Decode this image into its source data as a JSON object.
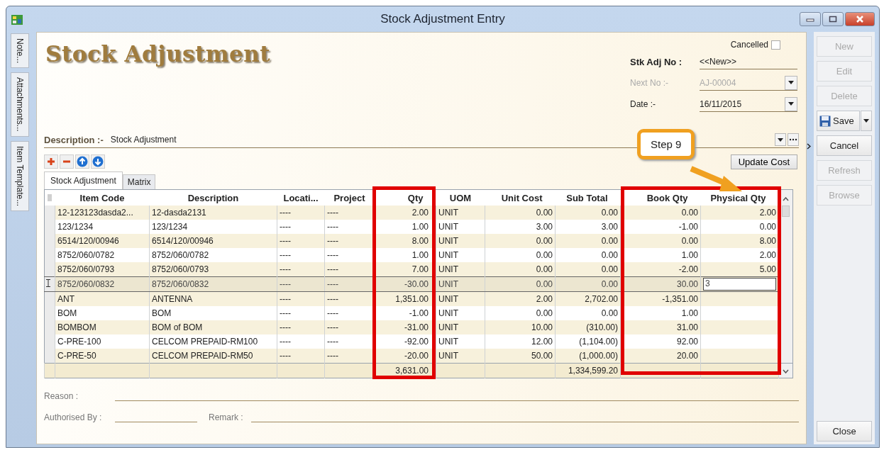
{
  "window": {
    "title": "Stock Adjustment Entry"
  },
  "side_tabs": [
    "Note...",
    "Attachments...",
    "Item Template..."
  ],
  "heading": "Stock Adjustment",
  "cancelled": {
    "label": "Cancelled",
    "checked": false
  },
  "fields": [
    {
      "kind": "text",
      "label": "Stk Adj No :",
      "value": "<<New>>",
      "disabled": false
    },
    {
      "kind": "combo",
      "label": "Next No :-",
      "value": "AJ-00004",
      "disabled": true
    },
    {
      "kind": "combo",
      "label": "Date :-",
      "value": "16/11/2015",
      "disabled": false
    }
  ],
  "description": {
    "label": "Description :-",
    "value": "Stock Adjustment"
  },
  "update_cost": "Update Cost",
  "tabs": [
    {
      "label": "Stock Adjustment",
      "selected": true
    },
    {
      "label": "Matrix",
      "selected": false
    }
  ],
  "callout": "Step 9",
  "table": {
    "columns": [
      "Item Code",
      "Description",
      "Locati...",
      "Project",
      "Qty",
      "UOM",
      "Unit Cost",
      "Sub Total",
      "Book Qty",
      "Physical Qty"
    ],
    "rows": [
      {
        "selected": false,
        "cells": [
          "12-123123dasda2...",
          "12-dasda2131",
          "----",
          "----",
          "2.00",
          "UNIT",
          "0.00",
          "0.00",
          "0.00",
          "2.00"
        ]
      },
      {
        "selected": false,
        "cells": [
          "123/1234",
          "123/1234",
          "----",
          "----",
          "1.00",
          "UNIT",
          "3.00",
          "3.00",
          "-1.00",
          "0.00"
        ]
      },
      {
        "selected": false,
        "cells": [
          "6514/120/00946",
          "6514/120/00946",
          "----",
          "----",
          "8.00",
          "UNIT",
          "0.00",
          "0.00",
          "0.00",
          "8.00"
        ]
      },
      {
        "selected": false,
        "cells": [
          "8752/060/0782",
          "8752/060/0782",
          "----",
          "----",
          "1.00",
          "UNIT",
          "0.00",
          "0.00",
          "1.00",
          "2.00"
        ]
      },
      {
        "selected": false,
        "cells": [
          "8752/060/0793",
          "8752/060/0793",
          "----",
          "----",
          "7.00",
          "UNIT",
          "0.00",
          "0.00",
          "-2.00",
          "5.00"
        ]
      },
      {
        "selected": true,
        "cells": [
          "8752/060/0832",
          "8752/060/0832",
          "----",
          "----",
          "-30.00",
          "UNIT",
          "0.00",
          "0.00",
          "30.00",
          "3"
        ]
      },
      {
        "selected": false,
        "cells": [
          "ANT",
          "ANTENNA",
          "----",
          "----",
          "1,351.00",
          "UNIT",
          "2.00",
          "2,702.00",
          "-1,351.00"
        ]
      },
      {
        "selected": false,
        "cells": [
          "BOM",
          "BOM",
          "----",
          "----",
          "-1.00",
          "UNIT",
          "0.00",
          "0.00",
          "1.00"
        ]
      },
      {
        "selected": false,
        "cells": [
          "BOMBOM",
          "BOM of BOM",
          "----",
          "----",
          "-31.00",
          "UNIT",
          "10.00",
          "(310.00)",
          "31.00"
        ]
      },
      {
        "selected": false,
        "cells": [
          "C-PRE-100",
          "CELCOM PREPAID-RM100",
          "----",
          "----",
          "-92.00",
          "UNIT",
          "12.00",
          "(1,104.00)",
          "92.00"
        ]
      },
      {
        "selected": false,
        "cells": [
          "C-PRE-50",
          "CELCOM PREPAID-RM50",
          "----",
          "----",
          "-20.00",
          "UNIT",
          "50.00",
          "(1,000.00)",
          "20.00"
        ]
      }
    ],
    "totals": {
      "qty": "3,631.00",
      "sub_total": "1,334,599.20"
    }
  },
  "bottom_fields": [
    {
      "label": "Reason :"
    },
    {
      "label": "Authorised By :"
    },
    {
      "label": "Remark :"
    }
  ],
  "actions": [
    {
      "kind": "plain",
      "label": "New",
      "disabled": true
    },
    {
      "kind": "plain",
      "label": "Edit",
      "disabled": true
    },
    {
      "kind": "plain",
      "label": "Delete",
      "disabled": true
    },
    {
      "kind": "save",
      "label": "Save",
      "disabled": false
    },
    {
      "kind": "plain",
      "label": "Cancel",
      "disabled": false
    },
    {
      "kind": "plain",
      "label": "Refresh",
      "disabled": true
    },
    {
      "kind": "plain",
      "label": "Browse",
      "disabled": true
    }
  ],
  "close_button": "Close"
}
